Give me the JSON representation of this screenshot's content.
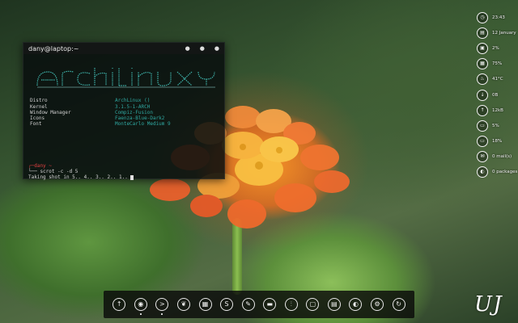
{
  "terminal": {
    "title": "dany@laptop:~",
    "controls": [
      "●",
      "●",
      "●"
    ],
    "info": [
      {
        "key": "Distro",
        "value": "ArchLinux  ()"
      },
      {
        "key": "Kernel",
        "value": "3.1.5-1-ARCH"
      },
      {
        "key": "Window Manager",
        "value": "Compiz-Fusion"
      },
      {
        "key": "Icons",
        "value": "Faenza-Blue-Dark2"
      },
      {
        "key": "Font",
        "value": "MonteCarlo Medium 9"
      }
    ],
    "prompt_user": "┌─dany ~",
    "prompt_tail": "~",
    "command": "└── scrot -c -d 5",
    "output": "Taking shot in 5.. 4.. 3.. 2.. 1.."
  },
  "status": [
    {
      "icon": "clock-icon",
      "glyph": "◷",
      "text": "23:43"
    },
    {
      "icon": "calendar-icon",
      "glyph": "▤",
      "text": "12 January"
    },
    {
      "icon": "cpu-icon",
      "glyph": "▣",
      "text": "2%"
    },
    {
      "icon": "memory-icon",
      "glyph": "▦",
      "text": "75%"
    },
    {
      "icon": "temperature-icon",
      "glyph": "♨",
      "text": "41°C"
    },
    {
      "icon": "download-icon",
      "glyph": "↓",
      "text": "0B"
    },
    {
      "icon": "upload-icon",
      "glyph": "↑",
      "text": "12kB"
    },
    {
      "icon": "disk-icon",
      "glyph": "▭",
      "text": "5%"
    },
    {
      "icon": "swap-icon",
      "glyph": "▭",
      "text": "18%"
    },
    {
      "icon": "mail-icon",
      "glyph": "✉",
      "text": "0 mail(s)"
    },
    {
      "icon": "package-icon",
      "glyph": "◐",
      "text": "0 packages"
    }
  ],
  "dock": [
    {
      "name": "upload-dock-icon",
      "glyph": "↑",
      "running": false
    },
    {
      "name": "browser-dock-icon",
      "glyph": "◉",
      "running": true
    },
    {
      "name": "terminal-dock-icon",
      "glyph": ">",
      "running": true
    },
    {
      "name": "leaf-dock-icon",
      "glyph": "❦",
      "running": false
    },
    {
      "name": "apps-grid-dock-icon",
      "glyph": "▦",
      "running": false
    },
    {
      "name": "skype-dock-icon",
      "glyph": "S",
      "running": false
    },
    {
      "name": "pencil-dock-icon",
      "glyph": "✎",
      "running": false
    },
    {
      "name": "folder-dock-icon",
      "glyph": "▬",
      "running": false
    },
    {
      "name": "mixer-dock-icon",
      "glyph": "⫶",
      "running": false
    },
    {
      "name": "chat-dock-icon",
      "glyph": "▢",
      "running": false
    },
    {
      "name": "calculator-dock-icon",
      "glyph": "▤",
      "running": false
    },
    {
      "name": "media-dock-icon",
      "glyph": "◐",
      "running": false
    },
    {
      "name": "settings-dock-icon",
      "glyph": "⚙",
      "running": false
    },
    {
      "name": "update-dock-icon",
      "glyph": "↻",
      "running": false
    }
  ],
  "signature": "UJ",
  "colors": {
    "accent": "#2fa7a0",
    "prompt_user": "#e04040",
    "dock_bg": "#0a0a0a"
  }
}
